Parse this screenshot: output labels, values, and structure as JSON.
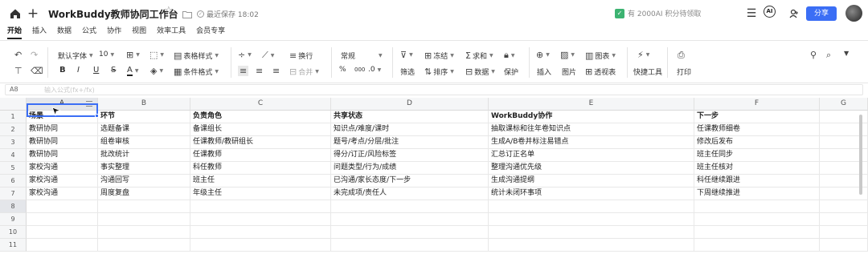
{
  "titlebar": {
    "title": "WorkBuddy教师协同工作台",
    "save_status": "最近保存 18:02",
    "promo": "有 2000AI 积分待领取",
    "share_label": "分享",
    "ai_label": "AI"
  },
  "tabs": [
    "开始",
    "插入",
    "数据",
    "公式",
    "协作",
    "视图",
    "效率工具",
    "会员专享"
  ],
  "ribbon": {
    "font_name": "默认字体",
    "font_size": "10",
    "table_style": "表格样式",
    "cond_format": "条件格式",
    "wrap": "换行",
    "merge": "合并",
    "number_format": "常规",
    "filter": "筛选",
    "freeze": "冻结",
    "sort": "排序",
    "sum": "求和",
    "data": "数据",
    "protect": "保护",
    "insert": "插入",
    "image": "图片",
    "chart": "图表",
    "pivot": "透视表",
    "quick_tools": "快捷工具",
    "print": "打印",
    "bold": "B",
    "italic": "I",
    "underline": "U",
    "strike": "S",
    "font_color": "A",
    "percent": "%",
    "thousands": "000",
    "decimal": ".0"
  },
  "formula_bar": {
    "cell_ref": "A8",
    "hint": "输入公式(fx+/fx)"
  },
  "columns": [
    "A",
    "B",
    "C",
    "D",
    "E",
    "F",
    "G"
  ],
  "rows": [
    "1",
    "2",
    "3",
    "4",
    "5",
    "6",
    "7",
    "8",
    "9",
    "10",
    "11"
  ],
  "table": [
    [
      "场景",
      "环节",
      "负责角色",
      "共享状态",
      "WorkBuddy协作",
      "下一步"
    ],
    [
      "教研协同",
      "选题备课",
      "备课组长",
      "知识点/难度/课时",
      "抽取课标和往年卷知识点",
      "任课教师细卷"
    ],
    [
      "教研协同",
      "组卷审核",
      "任课教师/教研组长",
      "题号/考点/分层/批注",
      "生成A/B卷并标注易错点",
      "修改后发布"
    ],
    [
      "教研协同",
      "批改统计",
      "任课教师",
      "得分/订正/风险标签",
      "汇总订正名单",
      "班主任同步"
    ],
    [
      "家校沟通",
      "事实整理",
      "科任教师",
      "问题类型/行为/成绩",
      "整理沟通优先级",
      "班主任核对"
    ],
    [
      "家校沟通",
      "沟通回写",
      "班主任",
      "已沟通/家长态度/下一步",
      "生成沟通提纲",
      "科任继续跟进"
    ],
    [
      "家校沟通",
      "周度复盘",
      "年级主任",
      "未完成项/责任人",
      "统计未闭环事项",
      "下周继续推进"
    ]
  ]
}
